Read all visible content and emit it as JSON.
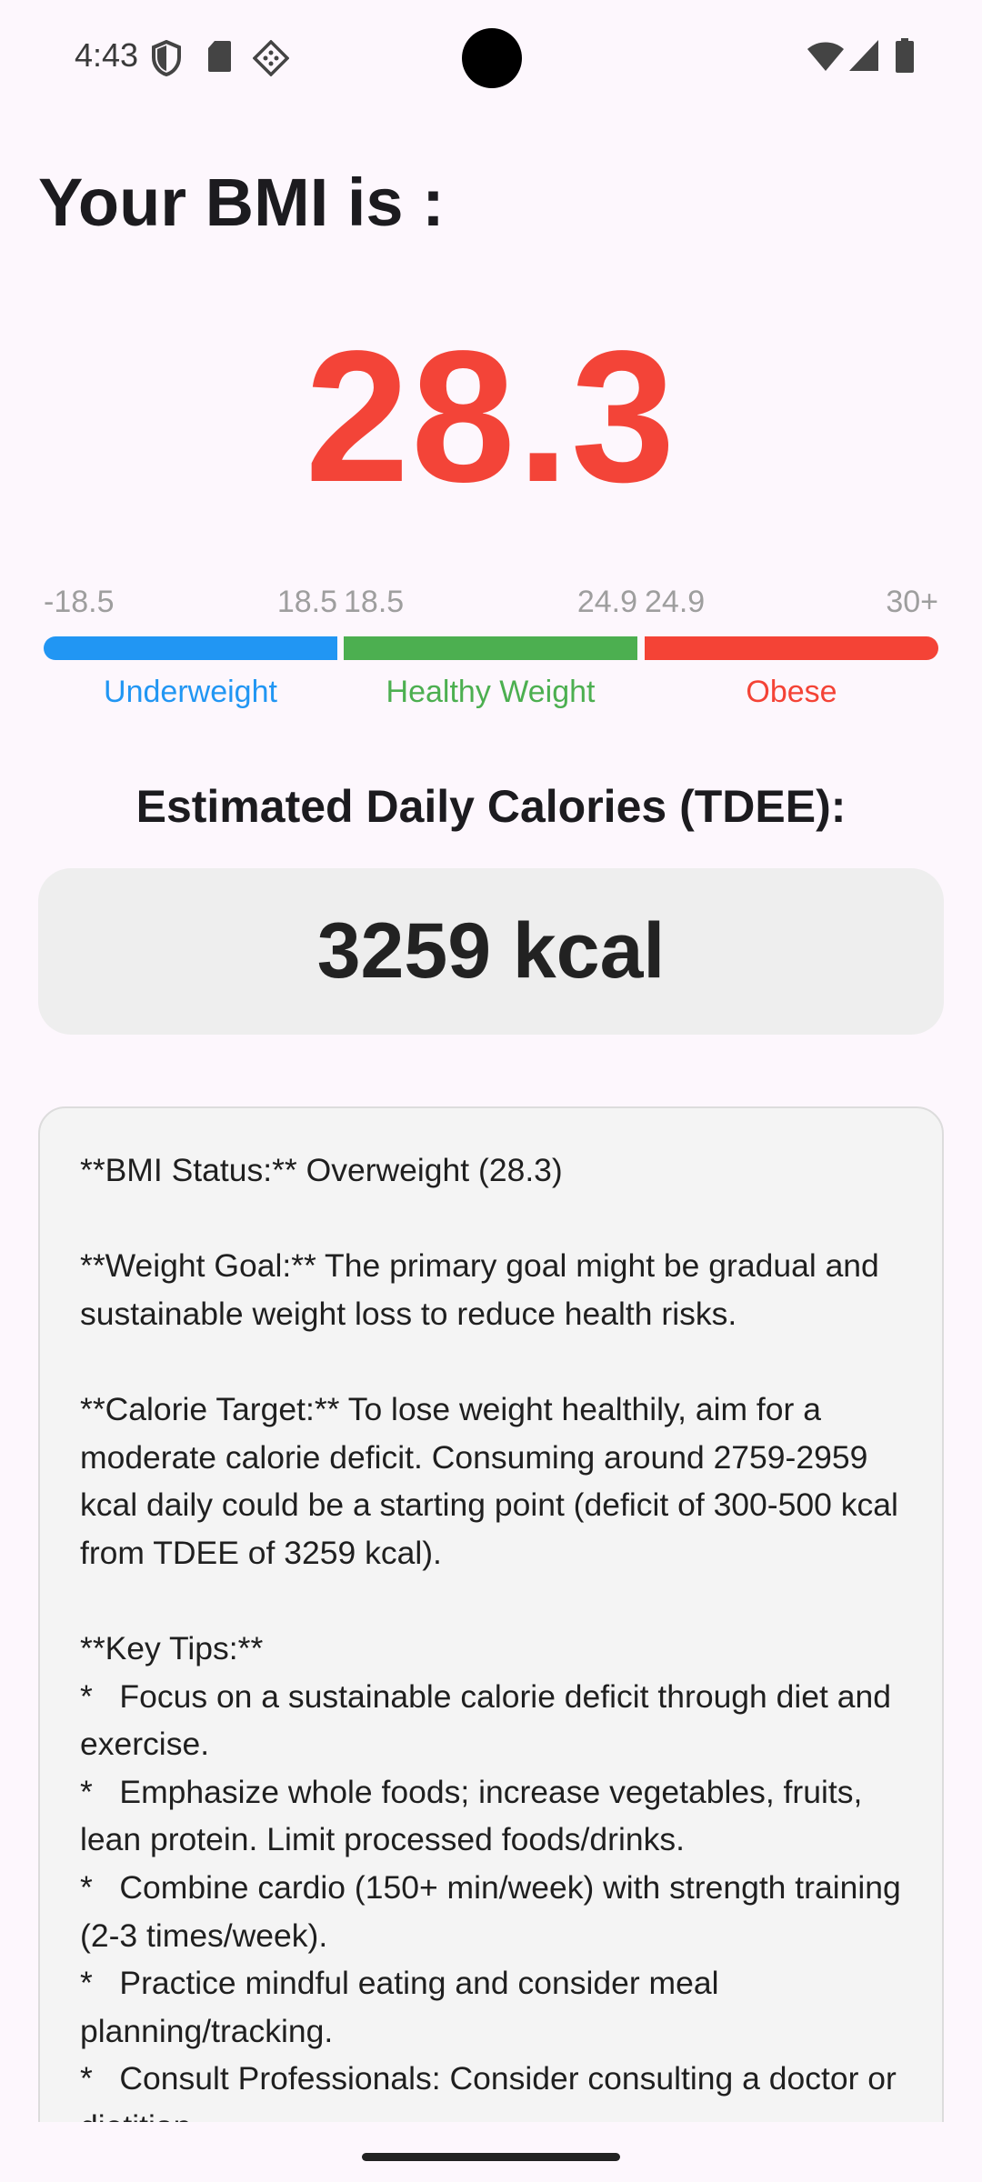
{
  "status_bar": {
    "time": "4:43",
    "icons_left": [
      "shield-icon",
      "sd-card-icon",
      "cast-diamond-icon"
    ],
    "icons_right": [
      "wifi-icon",
      "cellular-signal-icon",
      "battery-icon"
    ]
  },
  "title": "Your BMI is :",
  "bmi": {
    "value": "28.3",
    "color": "#f34438"
  },
  "scale": {
    "segments": [
      {
        "min": "-18.5",
        "max": "18.5",
        "label": "Underweight",
        "color": "#2196f3"
      },
      {
        "min": "18.5",
        "max": "24.9",
        "label": "Healthy Weight",
        "color": "#4caf50"
      },
      {
        "min": "24.9",
        "max": "30+",
        "label": "Obese",
        "color": "#f44336"
      }
    ]
  },
  "tdee": {
    "heading": "Estimated Daily Calories (TDEE):",
    "value": "3259 kcal"
  },
  "advice": {
    "text": "**BMI Status:** Overweight (28.3)\n\n**Weight Goal:** The primary goal might be gradual and sustainable weight loss to reduce health risks.\n\n**Calorie Target:** To lose weight healthily, aim for a moderate calorie deficit. Consuming around 2759-2959 kcal daily could be a starting point (deficit of 300-500 kcal from TDEE of 3259 kcal).\n\n**Key Tips:**\n*   Focus on a sustainable calorie deficit through diet and exercise.\n*   Emphasize whole foods; increase vegetables, fruits, lean protein. Limit processed foods/drinks.\n*   Combine cardio (150+ min/week) with strength training (2-3 times/week).\n*   Practice mindful eating and consider meal planning/tracking.\n*   Consult Professionals: Consider consulting a doctor or dietitian."
  }
}
